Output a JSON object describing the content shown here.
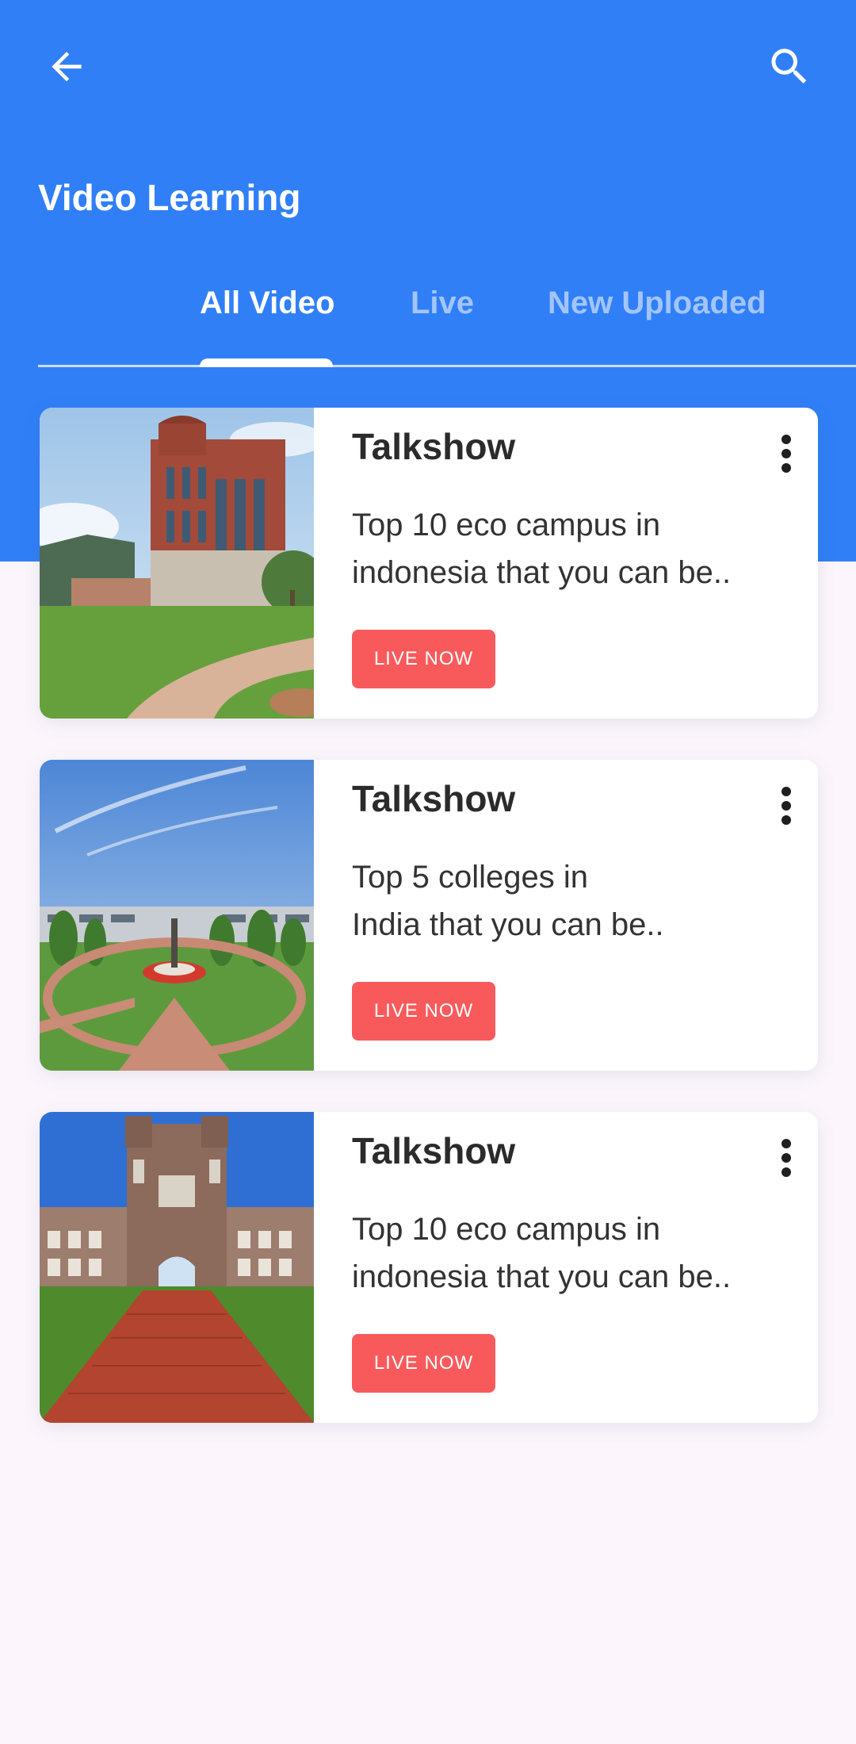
{
  "header": {
    "back_icon": "arrow-left-icon",
    "search_icon": "search-icon",
    "title": "Video Learning",
    "color": "#317ff7"
  },
  "tabs": [
    {
      "label": "All Video",
      "active": true
    },
    {
      "label": "Live",
      "active": false
    },
    {
      "label": "New Uploaded",
      "active": false
    }
  ],
  "cards": [
    {
      "title": "Talkshow",
      "description": "Top 10 eco campus in\nindonesia that you can be..",
      "button": "LIVE NOW",
      "more_icon": "more-vertical-icon"
    },
    {
      "title": "Talkshow",
      "description": "Top 5 colleges in\nIndia that you can be..",
      "button": "LIVE NOW",
      "more_icon": "more-vertical-icon"
    },
    {
      "title": "Talkshow",
      "description": "Top 10 eco campus in\nindonesia that you can be..",
      "button": "LIVE NOW",
      "more_icon": "more-vertical-icon"
    }
  ],
  "colors": {
    "live_button": "#f85a5b",
    "background": "#fcf6fc"
  }
}
